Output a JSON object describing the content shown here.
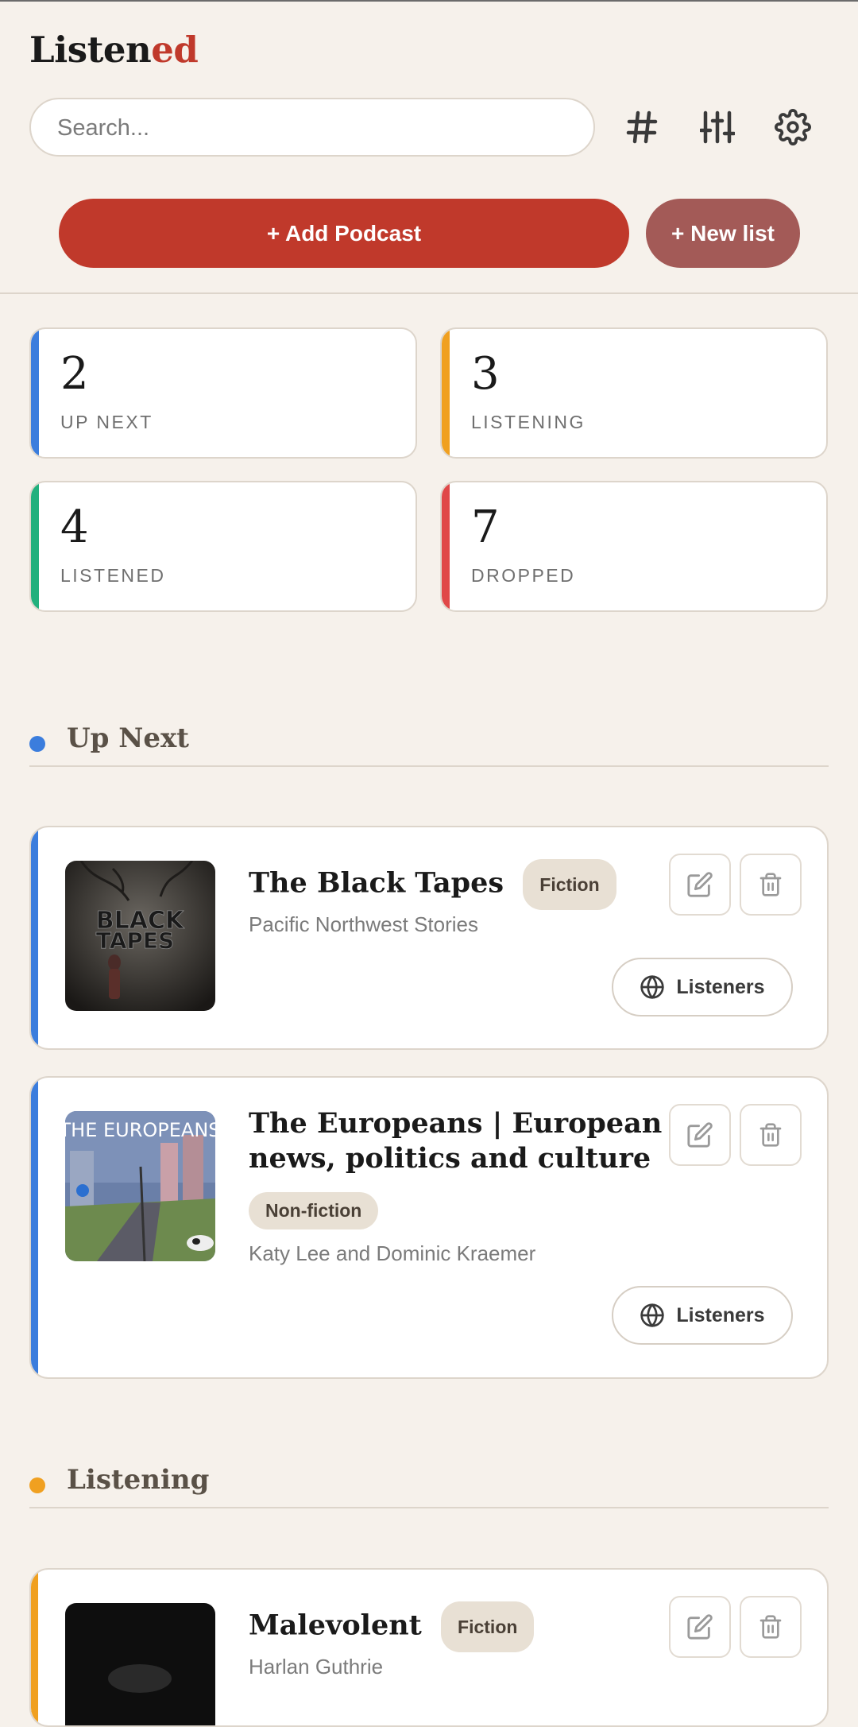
{
  "app": {
    "title_main": "Listen",
    "title_accent": "ed"
  },
  "search": {
    "placeholder": "Search..."
  },
  "toolbar": {
    "tags_icon": "hash-icon",
    "filter_icon": "sliders-icon",
    "settings_icon": "gear-icon"
  },
  "actions": {
    "add_podcast": "+ Add Podcast",
    "new_list": "+ New list"
  },
  "stats": [
    {
      "value": "2",
      "label": "UP NEXT",
      "color": "#3b7ddd"
    },
    {
      "value": "3",
      "label": "LISTENING",
      "color": "#f0a020"
    },
    {
      "value": "4",
      "label": "LISTENED",
      "color": "#22b07d"
    },
    {
      "value": "7",
      "label": "DROPPED",
      "color": "#e04848"
    }
  ],
  "sections": {
    "up_next": {
      "title": "Up Next",
      "color": "#3b7ddd",
      "items": [
        {
          "title": "The Black Tapes",
          "tag": "Fiction",
          "author": "Pacific Northwest Stories",
          "listeners": "Listeners",
          "cover_text_1": "BLACK",
          "cover_text_2": "TAPES"
        },
        {
          "title_line1": "The Europeans | European",
          "title_line2": "news, politics and culture",
          "tag": "Non-fiction",
          "author": "Katy Lee and Dominic Kraemer",
          "listeners": "Listeners",
          "cover_text": "THE EUROPEANS"
        }
      ]
    },
    "listening": {
      "title": "Listening",
      "color": "#f0a020",
      "items": [
        {
          "title": "Malevolent",
          "tag": "Fiction",
          "author": "Harlan Guthrie"
        }
      ]
    }
  }
}
